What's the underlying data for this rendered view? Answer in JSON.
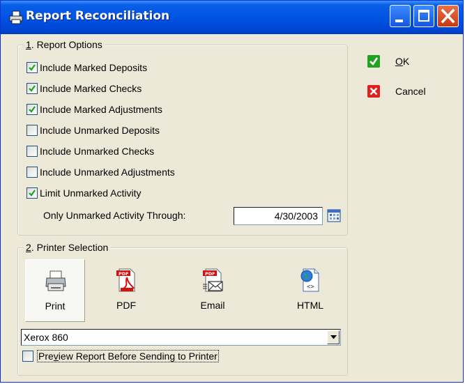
{
  "window": {
    "title": "Report Reconciliation"
  },
  "report_options": {
    "legend_number": "1",
    "legend_text": ". Report Options",
    "checkboxes": [
      {
        "label": "Include Marked Deposits",
        "checked": true
      },
      {
        "label": "Include Marked Checks",
        "checked": true
      },
      {
        "label": "Include Marked Adjustments",
        "checked": true
      },
      {
        "label": "Include Unmarked Deposits",
        "checked": false
      },
      {
        "label": "Include Unmarked Checks",
        "checked": false
      },
      {
        "label": "Include Unmarked Adjustments",
        "checked": false
      },
      {
        "label": "Limit Unmarked Activity",
        "checked": true
      }
    ],
    "date_label": "Only Unmarked Activity Through:",
    "date_value": "4/30/2003"
  },
  "buttons": {
    "ok_mnemonic": "O",
    "ok_rest": "K",
    "cancel": "Cancel"
  },
  "printer_selection": {
    "legend_number": "2",
    "legend_text": ". Printer Selection",
    "options": [
      {
        "label": "Print",
        "icon": "printer-icon",
        "selected": true
      },
      {
        "label": "PDF",
        "icon": "pdf-icon",
        "selected": false
      },
      {
        "label": "Email",
        "icon": "email-pdf-icon",
        "selected": false
      },
      {
        "label": "HTML",
        "icon": "html-icon",
        "selected": false
      }
    ],
    "printer_value": "Xerox 860",
    "preview_pre": "Pre",
    "preview_mnemonic": "v",
    "preview_rest": "iew Report Before Sending to Printer",
    "preview_checked": false
  },
  "colors": {
    "title_bar": "#0054e3",
    "dialog_bg": "#ece9d8",
    "check_green": "#21a121",
    "cancel_red": "#e0201c"
  }
}
